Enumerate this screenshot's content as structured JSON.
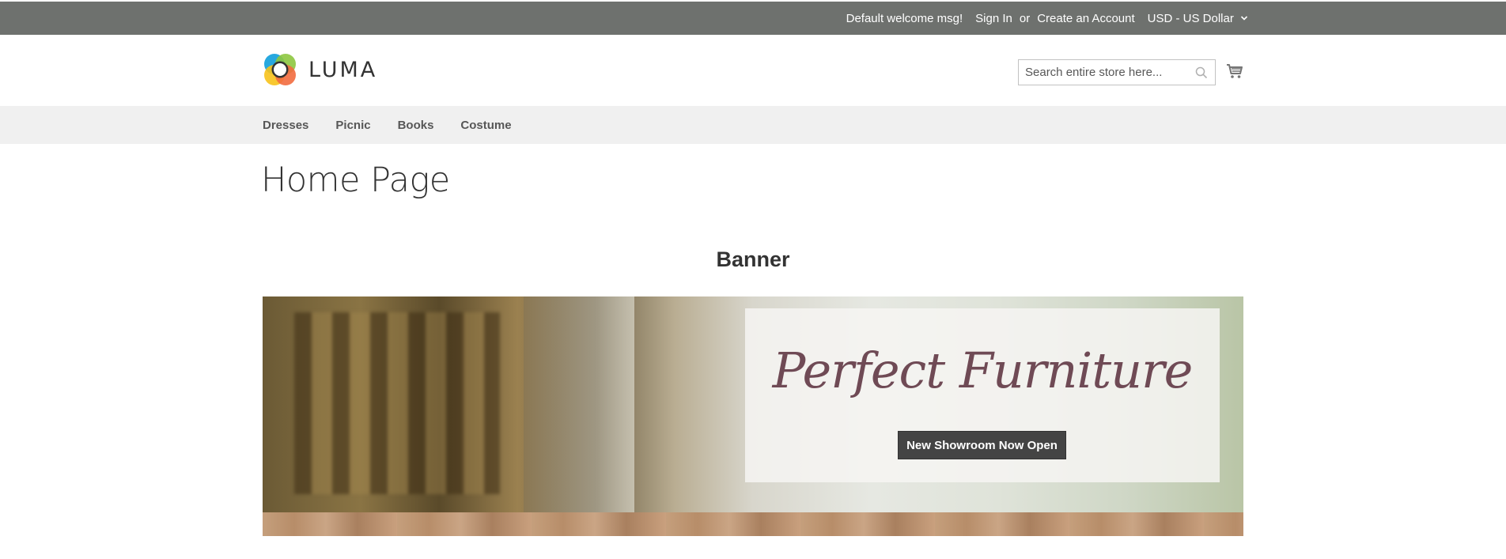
{
  "topbar": {
    "welcome": "Default welcome msg!",
    "sign_in": "Sign In",
    "or": "or",
    "create_account": "Create an Account",
    "currency": "USD - US Dollar",
    "currency_icon": "chevron-down-icon"
  },
  "header": {
    "logo_text": "LUMA",
    "search_placeholder": "Search entire store here...",
    "search_value": "",
    "search_icon": "search-icon",
    "cart_icon": "cart-icon"
  },
  "nav": {
    "items": [
      {
        "label": "Dresses"
      },
      {
        "label": "Picnic"
      },
      {
        "label": "Books"
      },
      {
        "label": "Costume"
      }
    ]
  },
  "main": {
    "page_title": "Home Page",
    "banner_heading": "Banner",
    "banner_script": "Perfect Furniture",
    "banner_button": "New Showroom Now Open"
  },
  "colors": {
    "topbar_bg": "#6e716e",
    "nav_bg": "#f0f0f0",
    "button_bg": "#444444",
    "script_color": "#6f4a55"
  }
}
